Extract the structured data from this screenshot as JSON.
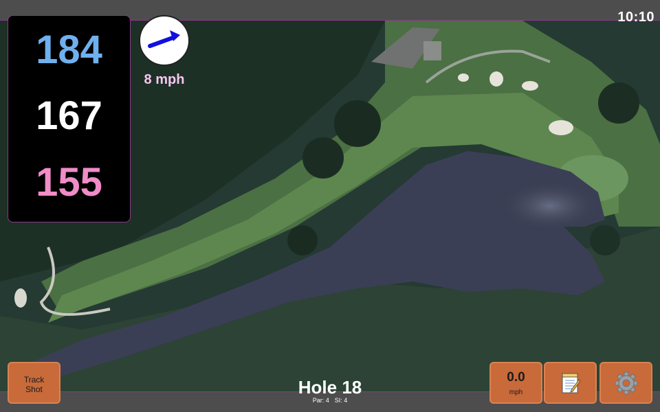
{
  "status": {
    "time": "10:10"
  },
  "distances": {
    "back": "184",
    "center": "167",
    "front": "155"
  },
  "wind": {
    "speed_label": "8 mph",
    "arrow_icon": "wind-arrow-icon"
  },
  "hole": {
    "title": "Hole 18",
    "par": "Par: 4",
    "stroke_index": "SI: 4"
  },
  "buttons": {
    "track_shot": "Track Shot",
    "speed_value": "0.0",
    "speed_unit": "mph",
    "notes_icon": "notepad-icon",
    "settings_icon": "gear-icon"
  },
  "colors": {
    "back_distance": "#6fb0ee",
    "center_distance": "#ffffff",
    "front_distance": "#f08cc8",
    "wind_text": "#f7c6ef",
    "button": "#c86a3a",
    "accent_border": "#8a3b8a"
  }
}
